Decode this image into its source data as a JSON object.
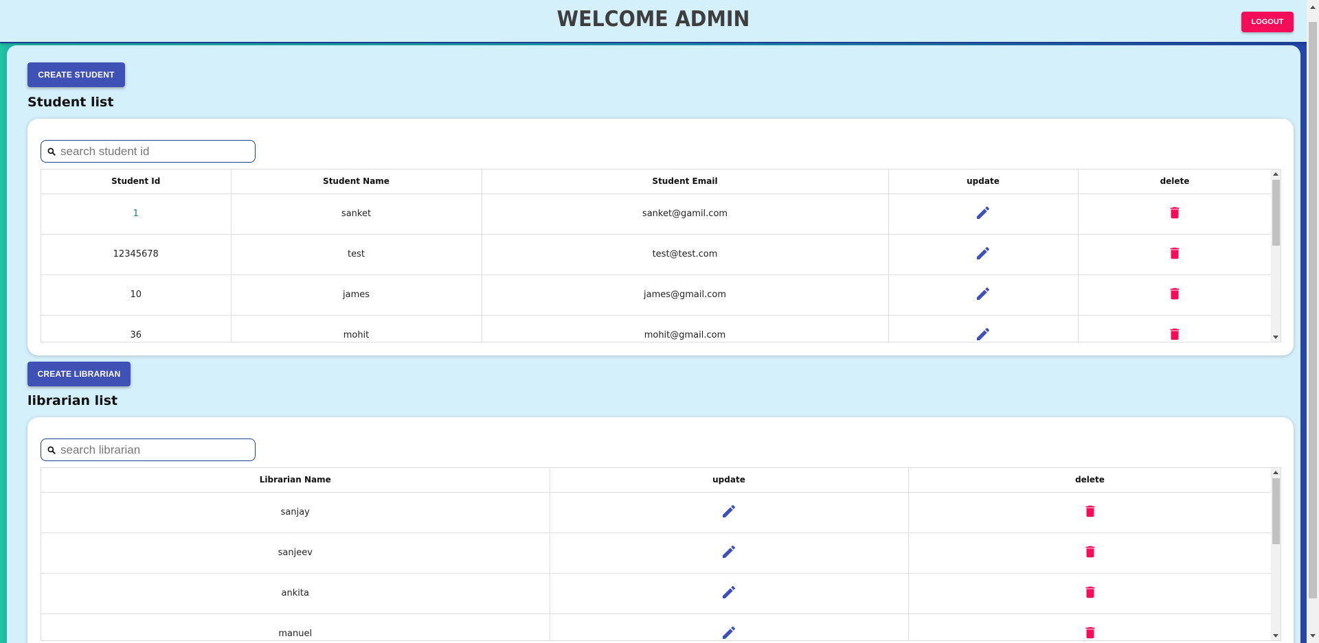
{
  "header": {
    "title": "WELCOME ADMIN",
    "logout_label": "LOGOUT"
  },
  "students": {
    "create_label": "CREATE STUDENT",
    "section_title": "Student list",
    "search_placeholder": "search student id",
    "search_value": "",
    "columns": [
      "Student Id",
      "Student Name",
      "Student Email",
      "update",
      "delete"
    ],
    "rows": [
      {
        "id": "1",
        "name": "sanket",
        "email": "sanket@gamil.com"
      },
      {
        "id": "12345678",
        "name": "test",
        "email": "test@test.com"
      },
      {
        "id": "10",
        "name": "james",
        "email": "james@gmail.com"
      },
      {
        "id": "36",
        "name": "mohit",
        "email": "mohit@gmail.com"
      }
    ]
  },
  "librarians": {
    "create_label": "CREATE LIBRARIAN",
    "section_title": "librarian list",
    "search_placeholder": "search librarian",
    "search_value": "",
    "columns": [
      "Librarian Name",
      "update",
      "delete"
    ],
    "rows": [
      {
        "name": "sanjay"
      },
      {
        "name": "sanjeev"
      },
      {
        "name": "ankita"
      },
      {
        "name": "manuel"
      }
    ]
  },
  "icons": {
    "search": "search-icon",
    "update": "pencil-icon",
    "delete": "trash-icon"
  },
  "colors": {
    "background": "#d4f0fb",
    "primary": "#3f51b5",
    "accent": "#f50d5a",
    "header_border": "#1b3f94",
    "gradient_left": "#1fc7a0",
    "gradient_right": "#2346a8"
  }
}
